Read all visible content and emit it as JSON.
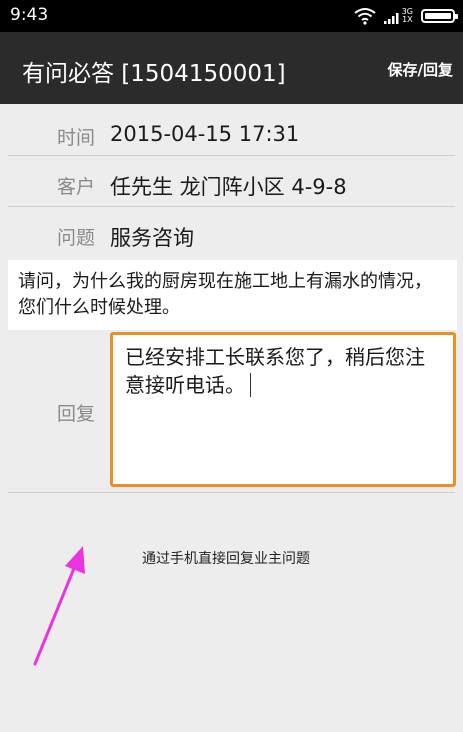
{
  "status_bar": {
    "time": "9:43",
    "network_type": "3G",
    "network_sub": "1X"
  },
  "app_bar": {
    "title": "有问必答 [1504150001]",
    "save_label": "保存/回复"
  },
  "fields": {
    "time": {
      "label": "时间",
      "value": "2015-04-15 17:31"
    },
    "customer": {
      "label": "客户",
      "value": "任先生 龙门阵小区 4-9-8"
    },
    "issue": {
      "label": "问题",
      "value": "服务咨询"
    }
  },
  "question": {
    "text": "请问，为什么我的厨房现在施工地上有漏水的情况，您们什么时候处理。"
  },
  "reply": {
    "label": "回复",
    "value": "已经安排工长联系您了，稍后您注意接听电话。"
  },
  "annotation": {
    "text": "通过手机直接回复业主问题",
    "arrow_color": "#e934e0"
  },
  "colors": {
    "accent": "#e98f28",
    "app_bar": "#2b2b2b"
  },
  "icons": [
    "wifi-icon",
    "signal-icon",
    "battery-icon"
  ]
}
